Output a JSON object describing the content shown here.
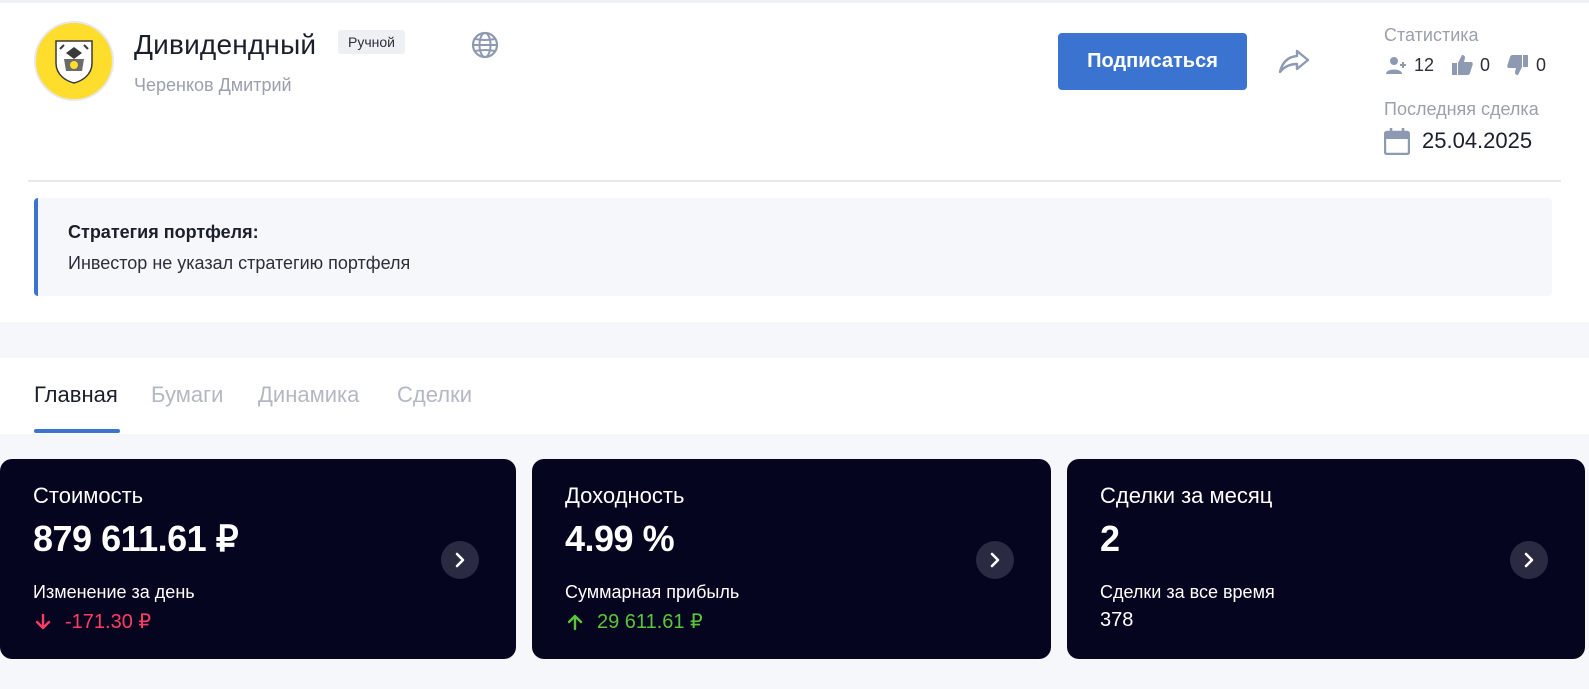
{
  "portfolio": {
    "title": "Дивидендный",
    "badge": "Ручной",
    "author": "Черенков Дмитрий",
    "avatar_icon": "bank-crest-icon",
    "globe_icon": "globe-icon"
  },
  "actions": {
    "subscribe_label": "Подписаться",
    "share_icon": "share-icon"
  },
  "stats": {
    "title": "Статистика",
    "subscribers": "12",
    "likes": "0",
    "dislikes": "0",
    "last_deal_title": "Последняя сделка",
    "last_deal_date": "25.04.2025"
  },
  "strategy": {
    "label": "Стратегия портфеля:",
    "text": "Инвестор не указал стратегию портфеля"
  },
  "tabs": [
    {
      "label": "Главная",
      "active": true
    },
    {
      "label": "Бумаги",
      "active": false
    },
    {
      "label": "Динамика",
      "active": false
    },
    {
      "label": "Сделки",
      "active": false
    }
  ],
  "cards": [
    {
      "label": "Стоимость",
      "value": "879 611.61 ₽",
      "sublabel": "Изменение за день",
      "subvalue": "-171.30 ₽",
      "trend": "down"
    },
    {
      "label": "Доходность",
      "value": "4.99 %",
      "sublabel": "Суммарная прибыль",
      "subvalue": "29 611.61 ₽",
      "trend": "up"
    },
    {
      "label": "Сделки за месяц",
      "value": "2",
      "sublabel": "Сделки за все время",
      "subvalue": "378",
      "trend": "none"
    }
  ],
  "colors": {
    "accent": "#3b74d0",
    "card_bg": "#05051f",
    "negative": "#ff3d64",
    "positive": "#5ac43a",
    "avatar_bg": "#ffdd2d"
  }
}
